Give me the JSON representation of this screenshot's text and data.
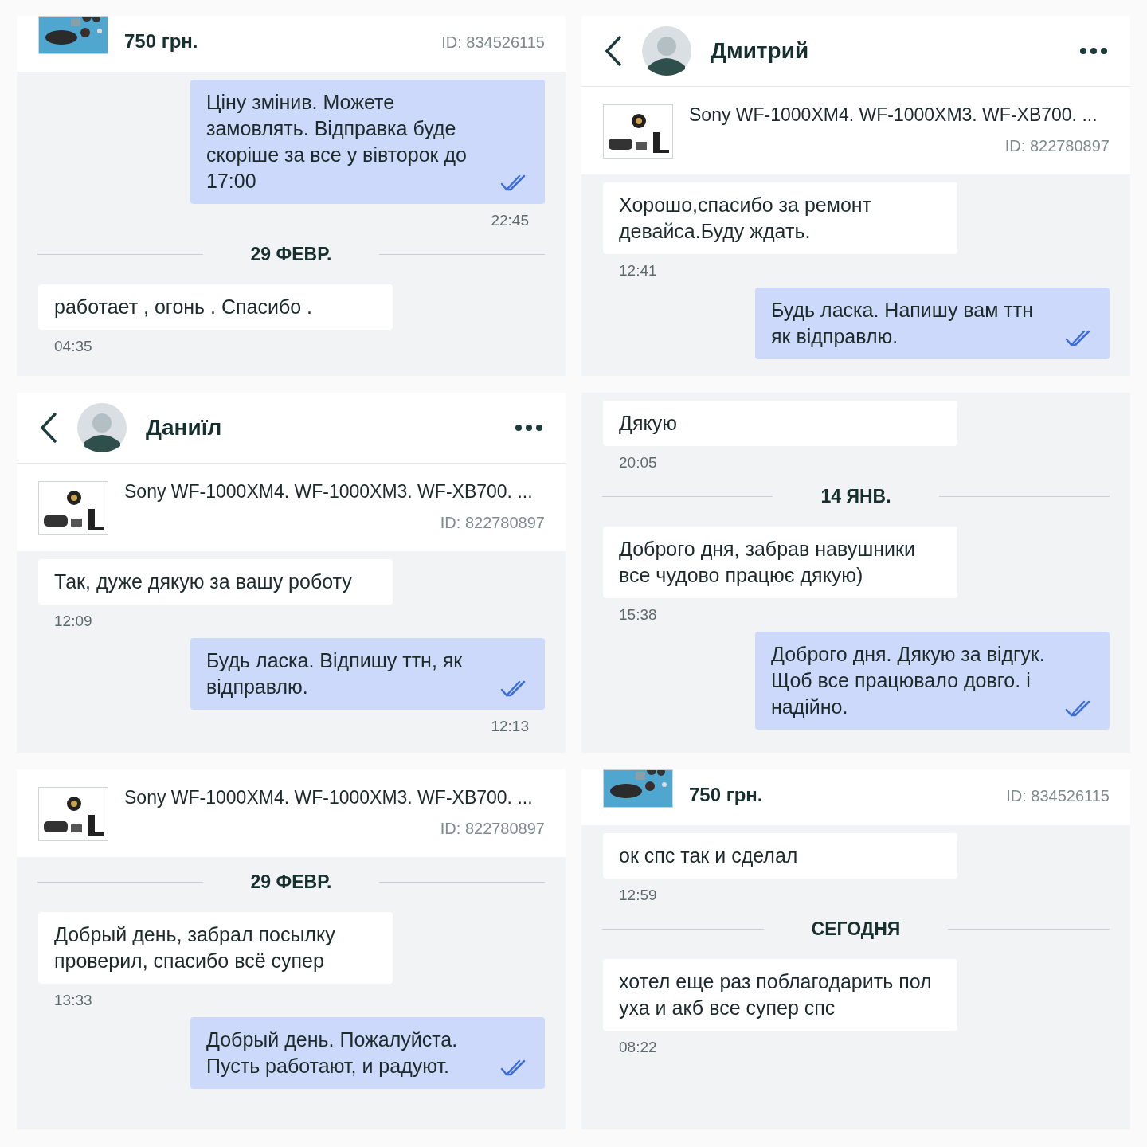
{
  "panels": [
    {
      "blocks": [
        {
          "kind": "product",
          "price": "750 грн.",
          "id": "ID: 834526115"
        },
        {
          "kind": "out",
          "text": "Ціну змінив. Можете замовлять. Відправка буде скоріше за все у вівторок до 17:00",
          "read": true,
          "time": "22:45"
        },
        {
          "kind": "date",
          "text": "29 ФЕВР."
        },
        {
          "kind": "in",
          "text": "работает , огонь . Спасибо .",
          "time": "04:35"
        }
      ]
    },
    {
      "blocks": [
        {
          "kind": "header",
          "name": "Дмитрий"
        },
        {
          "kind": "product",
          "title": "Sony WF-1000XM4. WF-1000XM3. WF-XB700. ...",
          "id": "ID: 822780897"
        },
        {
          "kind": "in",
          "text": "Хорошо,спасибо за ремонт девайса.Буду ждать.",
          "time": "12:41"
        },
        {
          "kind": "out",
          "text": "Будь ласка. Напишу вам ттн як відправлю.",
          "read": true
        }
      ]
    },
    {
      "blocks": [
        {
          "kind": "header",
          "name": "Даниїл"
        },
        {
          "kind": "product",
          "title": "Sony WF-1000XM4. WF-1000XM3. WF-XB700. ...",
          "id": "ID: 822780897"
        },
        {
          "kind": "in",
          "text": "Так, дуже дякую за вашу роботу",
          "time": "12:09"
        },
        {
          "kind": "out",
          "text": "Будь ласка. Відпишу ттн, як відправлю.",
          "read": true,
          "time": "12:13"
        }
      ]
    },
    {
      "blocks": [
        {
          "kind": "in",
          "text": "Дякую",
          "time": "20:05"
        },
        {
          "kind": "date",
          "text": "14 ЯНВ."
        },
        {
          "kind": "in",
          "text": "Доброго дня, забрав навушники все чудово працює дякую)",
          "time": "15:38"
        },
        {
          "kind": "out",
          "text": "Доброго дня. Дякую за відгук. Щоб все працювало довго. і надійно.",
          "read": true
        }
      ]
    },
    {
      "blocks": [
        {
          "kind": "product",
          "title": "Sony WF-1000XM4. WF-1000XM3. WF-XB700. ...",
          "id": "ID: 822780897"
        },
        {
          "kind": "date",
          "text": "29 ФЕВР."
        },
        {
          "kind": "in",
          "text": "Добрый день, забрал посылку проверил, спасибо всё супер",
          "time": "13:33"
        },
        {
          "kind": "out",
          "text": "Добрый день. Пожалуйста. Пусть работают, и радуют.",
          "read": true
        }
      ]
    },
    {
      "blocks": [
        {
          "kind": "product",
          "price": "750 грн.",
          "id": "ID: 834526115"
        },
        {
          "kind": "in",
          "text": "ок спс так и сделал",
          "time": "12:59"
        },
        {
          "kind": "date",
          "text": "СЕГОДНЯ"
        },
        {
          "kind": "in",
          "text": "хотел еще раз поблагодарить пол уха и акб все супер спс",
          "time": "08:22"
        }
      ]
    }
  ]
}
